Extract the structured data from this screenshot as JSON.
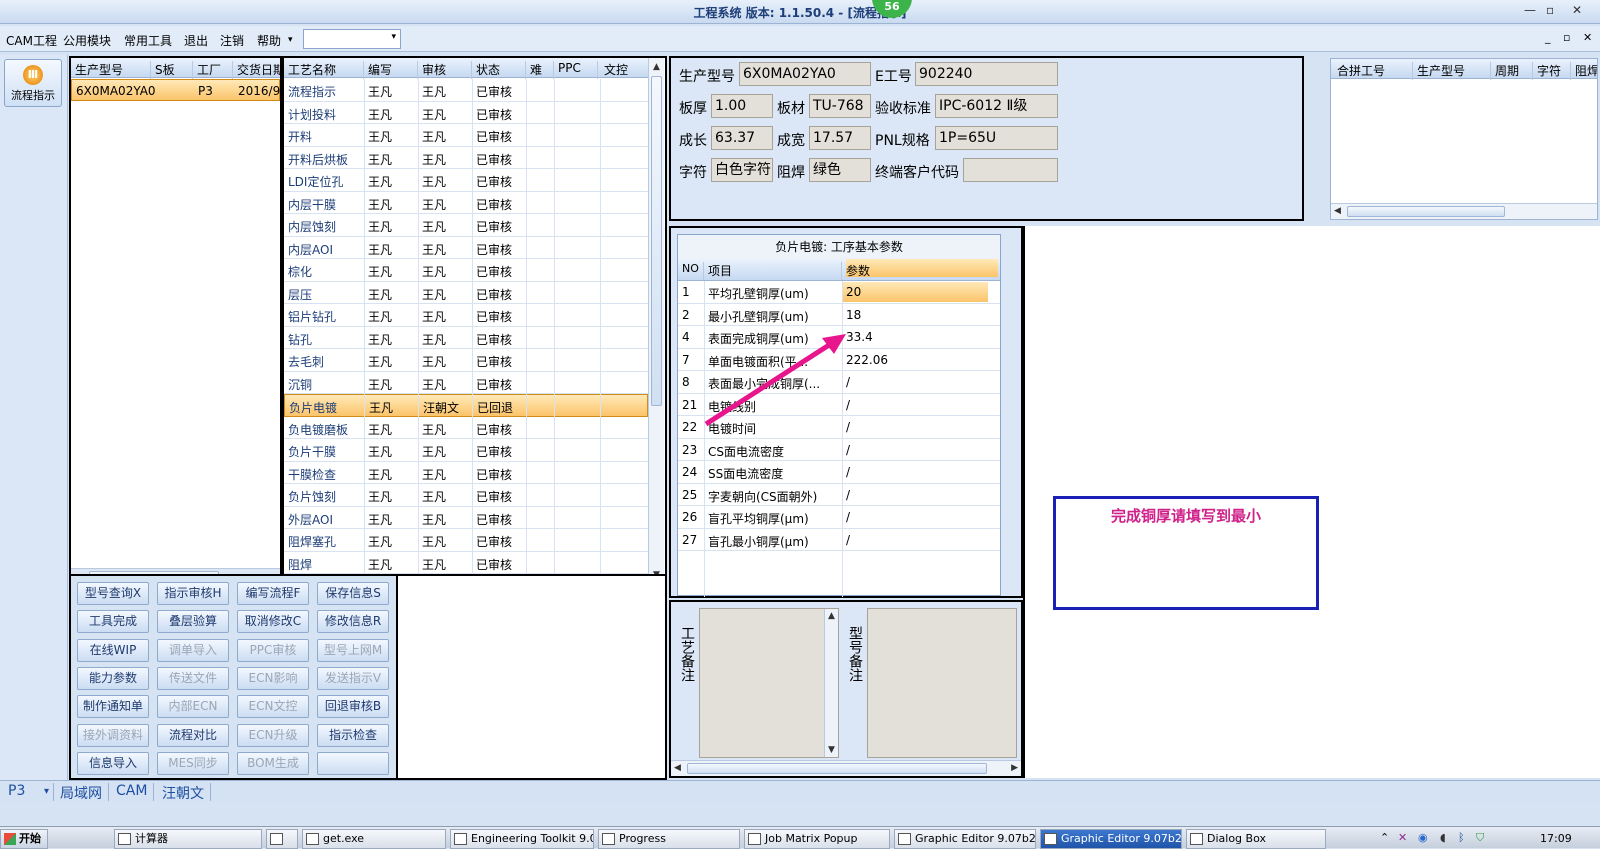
{
  "window": {
    "title": "工程系统  版本: 1.1.50.4 - [流程指示]",
    "badge": "56",
    "min": "—",
    "max": "▫",
    "close": "✕",
    "mdi_min": "_",
    "mdi_restore": "▫",
    "mdi_close": "✕"
  },
  "menu": {
    "items": [
      "CAM工程",
      "公用模块",
      "常用工具",
      "退出",
      "注销",
      "帮助"
    ],
    "extra": "▾",
    "combo_value": "",
    "combo_arrow": "▾"
  },
  "sidebar": {
    "flow_button_label": "流程指示",
    "flow_icon": "Ⅲ"
  },
  "model_list": {
    "headers": [
      "生产型号",
      "S板",
      "工厂",
      "交货日期"
    ],
    "rows": [
      {
        "model": "6X0MA02YA0",
        "s": "",
        "factory": "P3",
        "date": "2016/9/"
      }
    ]
  },
  "process_list": {
    "headers": [
      "工艺名称",
      "编写",
      "审核",
      "状态",
      "难",
      "PPC",
      "文控"
    ],
    "rows": [
      {
        "name": "流程指示",
        "writer": "王凡",
        "reviewer": "王凡",
        "status": "已审核"
      },
      {
        "name": "计划投料",
        "writer": "王凡",
        "reviewer": "王凡",
        "status": "已审核"
      },
      {
        "name": "开料",
        "writer": "王凡",
        "reviewer": "王凡",
        "status": "已审核"
      },
      {
        "name": "开料后烘板",
        "writer": "王凡",
        "reviewer": "王凡",
        "status": "已审核"
      },
      {
        "name": "LDI定位孔",
        "writer": "王凡",
        "reviewer": "王凡",
        "status": "已审核"
      },
      {
        "name": "内层干膜",
        "writer": "王凡",
        "reviewer": "王凡",
        "status": "已审核"
      },
      {
        "name": "内层蚀刻",
        "writer": "王凡",
        "reviewer": "王凡",
        "status": "已审核"
      },
      {
        "name": "内层AOI",
        "writer": "王凡",
        "reviewer": "王凡",
        "status": "已审核"
      },
      {
        "name": "棕化",
        "writer": "王凡",
        "reviewer": "王凡",
        "status": "已审核"
      },
      {
        "name": "层压",
        "writer": "王凡",
        "reviewer": "王凡",
        "status": "已审核"
      },
      {
        "name": "铝片钻孔",
        "writer": "王凡",
        "reviewer": "王凡",
        "status": "已审核"
      },
      {
        "name": "钻孔",
        "writer": "王凡",
        "reviewer": "王凡",
        "status": "已审核"
      },
      {
        "name": "去毛刺",
        "writer": "王凡",
        "reviewer": "王凡",
        "status": "已审核"
      },
      {
        "name": "沉铜",
        "writer": "王凡",
        "reviewer": "王凡",
        "status": "已审核"
      },
      {
        "name": "负片电镀",
        "writer": "王凡",
        "reviewer": "汪朝文",
        "status": "已回退"
      },
      {
        "name": "负电镀磨板",
        "writer": "王凡",
        "reviewer": "王凡",
        "status": "已审核"
      },
      {
        "name": "负片干膜",
        "writer": "王凡",
        "reviewer": "王凡",
        "status": "已审核"
      },
      {
        "name": "干膜检查",
        "writer": "王凡",
        "reviewer": "王凡",
        "status": "已审核"
      },
      {
        "name": "负片蚀刻",
        "writer": "王凡",
        "reviewer": "王凡",
        "status": "已审核"
      },
      {
        "name": "外层AOI",
        "writer": "王凡",
        "reviewer": "王凡",
        "status": "已审核"
      },
      {
        "name": "阻焊塞孔",
        "writer": "王凡",
        "reviewer": "王凡",
        "status": "已审核"
      },
      {
        "name": "阻焊",
        "writer": "王凡",
        "reviewer": "王凡",
        "status": "已审核"
      }
    ],
    "selected_index": 14
  },
  "buttons": [
    [
      {
        "label": "型号查询X",
        "enabled": true
      },
      {
        "label": "指示审核H",
        "enabled": true
      },
      {
        "label": "编写流程F",
        "enabled": true
      },
      {
        "label": "保存信息S",
        "enabled": true
      }
    ],
    [
      {
        "label": "工具完成",
        "enabled": true
      },
      {
        "label": "叠层验算",
        "enabled": true
      },
      {
        "label": "取消修改C",
        "enabled": true
      },
      {
        "label": "修改信息R",
        "enabled": true
      }
    ],
    [
      {
        "label": "在线WIP",
        "enabled": true
      },
      {
        "label": "调单导入",
        "enabled": false
      },
      {
        "label": "PPC审核",
        "enabled": false
      },
      {
        "label": "型号上网M",
        "enabled": false
      }
    ],
    [
      {
        "label": "能力参数",
        "enabled": true
      },
      {
        "label": "传送文件",
        "enabled": false
      },
      {
        "label": "ECN影响",
        "enabled": false
      },
      {
        "label": "发送指示V",
        "enabled": false
      }
    ],
    [
      {
        "label": "制作通知单",
        "enabled": true
      },
      {
        "label": "内部ECN",
        "enabled": false
      },
      {
        "label": "ECN文控",
        "enabled": false
      },
      {
        "label": "回退审核B",
        "enabled": true
      }
    ],
    [
      {
        "label": "接外调资料",
        "enabled": false
      },
      {
        "label": "流程对比",
        "enabled": true
      },
      {
        "label": "ECN升级",
        "enabled": false
      },
      {
        "label": "指示检查",
        "enabled": true
      }
    ],
    [
      {
        "label": "信息导入",
        "enabled": true
      },
      {
        "label": "MES同步",
        "enabled": false
      },
      {
        "label": "BOM生成",
        "enabled": false
      },
      {
        "label": "",
        "enabled": true
      }
    ]
  ],
  "info": {
    "model_label": "生产型号",
    "model_value": "6X0MA02YA0",
    "e_label": "E工号",
    "e_value": "902240",
    "thickness_label": "板厚",
    "thickness_value": "1.00",
    "material_label": "板材",
    "material_value": "TU-768",
    "standard_label": "验收标准",
    "standard_value": "IPC-6012 Ⅱ级",
    "length_label": "成长",
    "length_value": "63.37",
    "width_label": "成宽",
    "width_value": "17.57",
    "pnl_label": "PNL规格",
    "pnl_value": "1P=65U",
    "char_label": "字符",
    "char_value": "白色字符",
    "mask_label": "阻焊",
    "mask_value": "绿色",
    "customer_label": "终端客户代码",
    "customer_value": ""
  },
  "merge_table": {
    "headers": [
      "合拼工号",
      "生产型号",
      "周期",
      "字符",
      "阻焊"
    ]
  },
  "params": {
    "title": "负片电镀: 工序基本参数",
    "headers": [
      "NO",
      "项目",
      "参数"
    ],
    "rows": [
      {
        "no": "1",
        "item": "平均孔壁铜厚(um)",
        "value": "20"
      },
      {
        "no": "2",
        "item": "最小孔壁铜厚(um)",
        "value": "18"
      },
      {
        "no": "4",
        "item": "表面完成铜厚(um)",
        "value": "33.4"
      },
      {
        "no": "7",
        "item": "单面电镀面积(平...",
        "value": "222.06"
      },
      {
        "no": "8",
        "item": "表面最小完成铜厚(...",
        "value": "/"
      },
      {
        "no": "21",
        "item": "电镀线别",
        "value": "/"
      },
      {
        "no": "22",
        "item": "电镀时间",
        "value": "/"
      },
      {
        "no": "23",
        "item": "CS面电流密度",
        "value": "/"
      },
      {
        "no": "24",
        "item": "SS面电流密度",
        "value": "/"
      },
      {
        "no": "25",
        "item": "字麦朝向(CS面朝外)",
        "value": "/"
      },
      {
        "no": "26",
        "item": "盲孔平均铜厚(μm)",
        "value": "/"
      },
      {
        "no": "27",
        "item": "盲孔最小铜厚(μm)",
        "value": "/"
      }
    ]
  },
  "notes": {
    "process_label": "工艺备注",
    "model_label": "型号备注"
  },
  "annotation": {
    "text": "完成铜厚请填写到最小",
    "color": "#d0208a"
  },
  "arrow_color": "#e8168c",
  "status": {
    "factory": "P3",
    "dropdown": "▾",
    "network": "局域网",
    "module": "CAM",
    "user": "汪朝文"
  },
  "taskbar": {
    "start": "开始",
    "items": [
      "计算器",
      "",
      "get.exe",
      "Engineering Toolkit 9.0...",
      "Progress",
      "Job Matrix Popup",
      "Graphic Editor 9.07b2 (...",
      "Graphic Editor 9.07b2 (...",
      "Dialog Box"
    ],
    "active_index": 7,
    "clock": "17:09"
  }
}
